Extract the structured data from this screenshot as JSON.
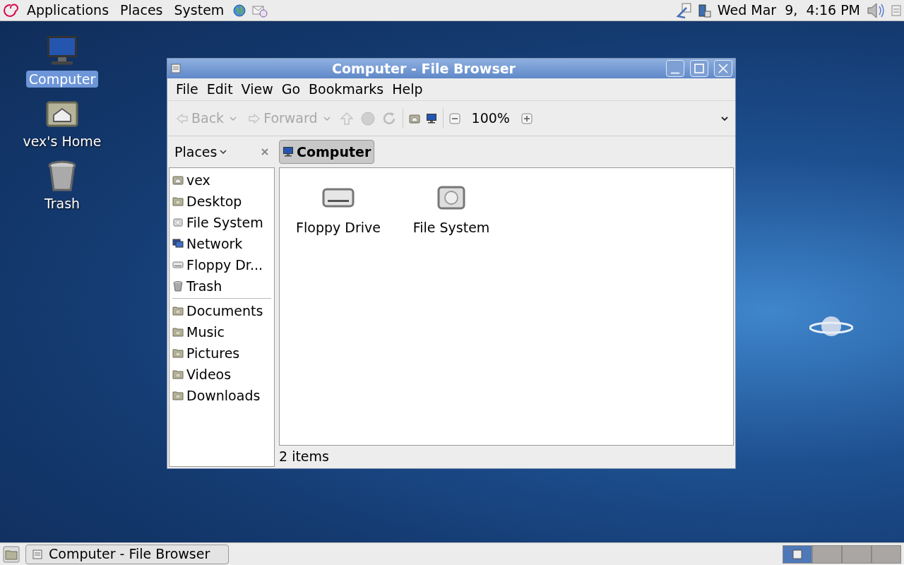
{
  "top_panel": {
    "menus": [
      "Applications",
      "Places",
      "System"
    ],
    "clock": "Wed Mar  9,  4:16 PM"
  },
  "desktop_icons": [
    {
      "label": "Computer",
      "kind": "computer",
      "selected": true
    },
    {
      "label": "vex's Home",
      "kind": "home",
      "selected": false
    },
    {
      "label": "Trash",
      "kind": "trash",
      "selected": false
    }
  ],
  "window": {
    "title": "Computer - File Browser",
    "menu": [
      "File",
      "Edit",
      "View",
      "Go",
      "Bookmarks",
      "Help"
    ],
    "toolbar": {
      "back": {
        "label": "Back",
        "disabled": true
      },
      "forward": {
        "label": "Forward",
        "disabled": true
      },
      "zoom": "100%"
    },
    "sidebar": {
      "title": "Places",
      "devices": [
        {
          "label": "vex",
          "kind": "home"
        },
        {
          "label": "Desktop",
          "kind": "folder"
        },
        {
          "label": "File System",
          "kind": "drive"
        },
        {
          "label": "Network",
          "kind": "network"
        },
        {
          "label": "Floppy Dr...",
          "kind": "floppy"
        },
        {
          "label": "Trash",
          "kind": "trash"
        }
      ],
      "bookmarks": [
        {
          "label": "Documents",
          "kind": "folder"
        },
        {
          "label": "Music",
          "kind": "folder"
        },
        {
          "label": "Pictures",
          "kind": "folder"
        },
        {
          "label": "Videos",
          "kind": "folder"
        },
        {
          "label": "Downloads",
          "kind": "folder"
        }
      ]
    },
    "path": [
      {
        "label": "Computer",
        "selected": true
      }
    ],
    "items": [
      {
        "label": "Floppy Drive",
        "kind": "floppy"
      },
      {
        "label": "File System",
        "kind": "drive"
      }
    ],
    "status": "2 items"
  },
  "taskbar": {
    "tasks": [
      {
        "label": "Computer - File Browser",
        "selected": false
      }
    ],
    "workspaces": [
      {
        "selected": true
      },
      {
        "selected": false
      },
      {
        "selected": false
      },
      {
        "selected": false
      }
    ]
  }
}
